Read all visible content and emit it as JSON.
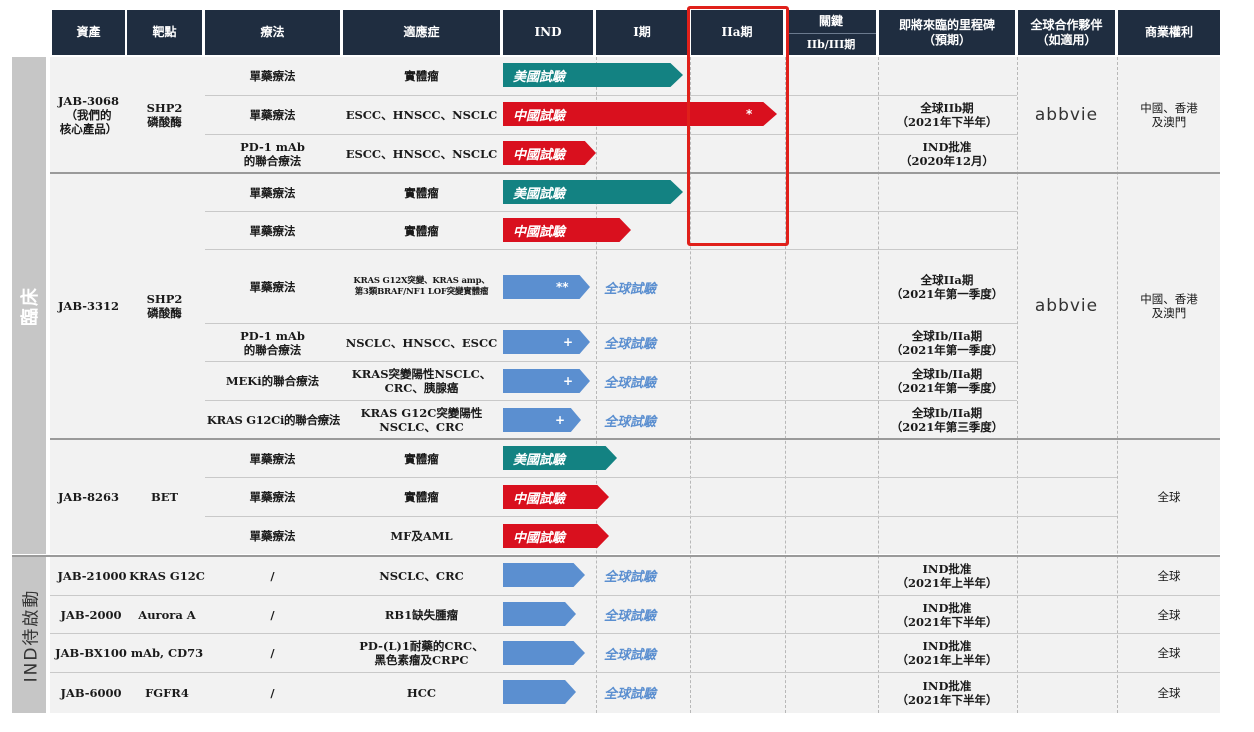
{
  "headers": {
    "asset": "資產",
    "target": "靶點",
    "therapy": "療法",
    "indication": "適應症",
    "ind": "IND",
    "phase1": "I期",
    "phase2a": "IIa期",
    "pivotal_top": "關鍵",
    "pivotal_bottom": "IIb/III期",
    "milestone": "即將來臨的里程碑\n（預期）",
    "partner": "全球合作夥伴\n（如適用）",
    "rights": "商業權利"
  },
  "sections": {
    "clinical": "臨床",
    "ind_enabling": "IND待啟動"
  },
  "labels": {
    "us_trial": "美國試驗",
    "cn_trial": "中國試驗",
    "global_trial": "全球試驗",
    "partner_logo": "abbvie"
  },
  "assets": {
    "jab3068": {
      "name": "JAB-3068\n（我們的\n核心產品）",
      "target": "SHP2\n磷酸酶",
      "rights": "中國、香港\n及澳門"
    },
    "jab3312": {
      "name": "JAB-3312",
      "target": "SHP2\n磷酸酶",
      "rights": "中國、香港\n及澳門"
    },
    "jab8263": {
      "name": "JAB-8263",
      "target": "BET",
      "rights": "全球"
    }
  },
  "rows": [
    {
      "therapy": "單藥療法",
      "indication": "實體瘤",
      "milestone": ""
    },
    {
      "therapy": "單藥療法",
      "indication": "ESCC、HNSCC、NSCLC",
      "mark": "*",
      "milestone": "全球IIb期\n（2021年下半年）"
    },
    {
      "therapy": "PD-1 mAb\n的聯合療法",
      "indication": "ESCC、HNSCC、NSCLC",
      "milestone": "IND批准\n（2020年12月）"
    },
    {
      "therapy": "單藥療法",
      "indication": "實體瘤",
      "milestone": ""
    },
    {
      "therapy": "單藥療法",
      "indication": "實體瘤",
      "milestone": ""
    },
    {
      "therapy": "單藥療法",
      "indication": "KRAS G12X突變、KRAS amp、\n第3類BRAF/NF1 LOF突變實體瘤",
      "mark": "**",
      "milestone": "全球IIa期\n（2021年第一季度）"
    },
    {
      "therapy": "PD-1 mAb\n的聯合療法",
      "indication": "NSCLC、HNSCC、ESCC",
      "mark": "+",
      "milestone": "全球Ib/IIa期\n（2021年第一季度）"
    },
    {
      "therapy": "MEKi的聯合療法",
      "indication": "KRAS突變陽性NSCLC、\nCRC、胰腺癌",
      "mark": "+",
      "milestone": "全球Ib/IIa期\n（2021年第一季度）"
    },
    {
      "therapy": "KRAS G12Ci的聯合療法",
      "indication": "KRAS G12C突變陽性\nNSCLC、CRC",
      "mark": "+",
      "milestone": "全球Ib/IIa期\n（2021年第三季度）"
    },
    {
      "therapy": "單藥療法",
      "indication": "實體瘤",
      "milestone": ""
    },
    {
      "therapy": "單藥療法",
      "indication": "實體瘤",
      "milestone": ""
    },
    {
      "therapy": "單藥療法",
      "indication": "MF及AML",
      "milestone": ""
    },
    {
      "asset": "JAB-21000",
      "target": "KRAS G12C",
      "therapy": "/",
      "indication": "NSCLC、CRC",
      "milestone": "IND批准\n（2021年上半年）",
      "rights": "全球"
    },
    {
      "asset": "JAB-2000",
      "target": "Aurora A",
      "therapy": "/",
      "indication": "RB1缺失腫瘤",
      "milestone": "IND批准\n（2021年下半年）",
      "rights": "全球"
    },
    {
      "asset": "JAB-BX100",
      "target": "mAb, CD73",
      "therapy": "/",
      "indication": "PD-(L)1耐藥的CRC、\n黑色素瘤及CRPC",
      "milestone": "IND批准\n（2021年上半年）",
      "rights": "全球"
    },
    {
      "asset": "JAB-6000",
      "target": "FGFR4",
      "therapy": "/",
      "indication": "HCC",
      "milestone": "IND批准\n（2021年下半年）",
      "rights": "全球"
    }
  ],
  "colors": {
    "header_bg": "#1f2d40",
    "us_trial": "#138282",
    "cn_trial": "#d9101e",
    "global_trial": "#5b8fd0",
    "highlight_box": "#e0201a"
  }
}
